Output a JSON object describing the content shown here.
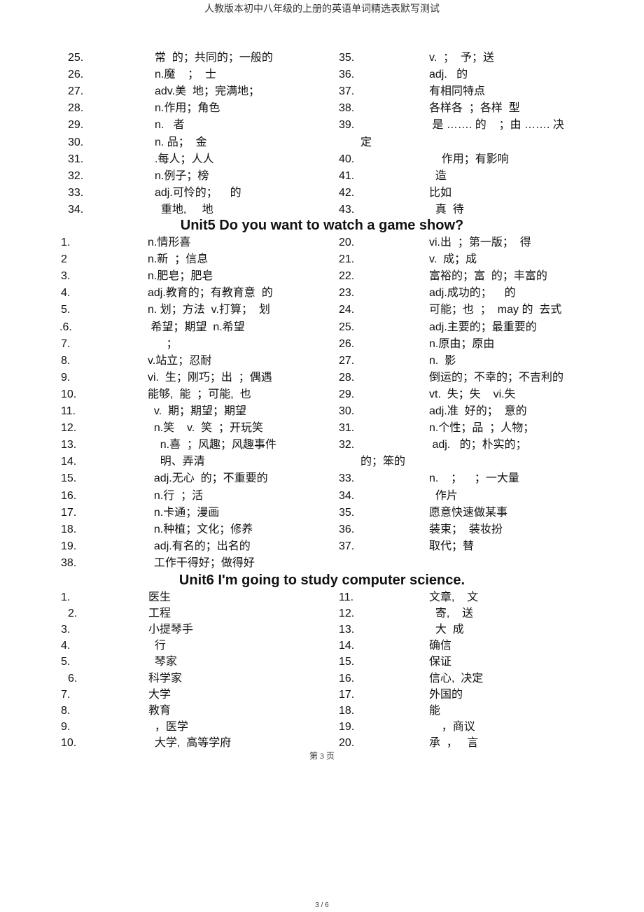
{
  "header": {
    "title": "人教版本初中八年级的上册的英语单词精选表默写测试"
  },
  "section_top": {
    "left": [
      {
        "num": "25.",
        "text": "常  的；共同的；一般的"
      },
      {
        "num": "26.",
        "text": "n.魔    ；  士"
      },
      {
        "num": "27.",
        "text": "adv.美  地；完满地；"
      },
      {
        "num": "28.",
        "text": "n.作用；角色"
      },
      {
        "num": "29.",
        "text": "n.   者"
      },
      {
        "num": "30.",
        "text": "n. 品；  金"
      },
      {
        "num": "31.",
        "text": ".每人；人人"
      },
      {
        "num": "32.",
        "text": "n.例子；榜"
      },
      {
        "num": "33.",
        "text": "adj.可怜的；    的"
      },
      {
        "num": "34.",
        "text": "  重地,     地"
      }
    ],
    "right": [
      {
        "num": "35.",
        "text": "v.  ；  予；送"
      },
      {
        "num": "36.",
        "text": "adj.   的"
      },
      {
        "num": "37.",
        "text": "有相同特点"
      },
      {
        "num": "38.",
        "text": "各样各  ；各样  型"
      },
      {
        "num": "39.",
        "text": " 是 ……. 的    ；由 ……. 决"
      },
      {
        "num": "",
        "text": "定"
      },
      {
        "num": "40.",
        "text": "    作用；有影响"
      },
      {
        "num": "41.",
        "text": "  造"
      },
      {
        "num": "42.",
        "text": "比如"
      },
      {
        "num": "43.",
        "text": "  真  待"
      }
    ]
  },
  "unit5": {
    "heading": "Unit5 Do you want to watch a game show?",
    "left": [
      {
        "num": "1.",
        "text": "n.情形喜"
      },
      {
        "num": "2",
        "text": "n.新  ；信息"
      },
      {
        "num": "3.",
        "text": "n.肥皂；肥皂"
      },
      {
        "num": "4.",
        "text": "adj.教育的；有教育意  的"
      },
      {
        "num": "5.",
        "text": "n. 划；方法  v.打算；  划"
      },
      {
        "num": ".6.",
        "text": " 希望；期望  n.希望"
      },
      {
        "num": "7.",
        "text": "      ；"
      },
      {
        "num": "8.",
        "text": "v.站立；忍耐"
      },
      {
        "num": "9.",
        "text": "vi.  生；刚巧；出  ；偶遇"
      },
      {
        "num": "10.",
        "text": "能够,  能  ；可能,  也"
      },
      {
        "num": "11.",
        "text": "  v.  期；期望；期望"
      },
      {
        "num": "12.",
        "text": "  n.笑    v.  笑  ；开玩笑"
      },
      {
        "num": "13.",
        "text": "    n.喜  ；风趣；风趣事件"
      },
      {
        "num": "14.",
        "text": "    明、弄清"
      },
      {
        "num": "15.",
        "text": "  adj.无心  的；不重要的"
      },
      {
        "num": "16.",
        "text": "  n.行  ；活"
      },
      {
        "num": "17.",
        "text": "  n.卡通；漫画"
      },
      {
        "num": "18.",
        "text": "  n.种植；文化；修养"
      },
      {
        "num": "19.",
        "text": "  adj.有名的；出名的"
      },
      {
        "num": "38.",
        "text": "  工作干得好；做得好"
      }
    ],
    "right": [
      {
        "num": "20.",
        "text": "vi.出  ；第一版；  得"
      },
      {
        "num": "21.",
        "text": "v.  成；成"
      },
      {
        "num": "22.",
        "text": "富裕的；富  的；丰富的"
      },
      {
        "num": "23.",
        "text": "adj.成功的；    的"
      },
      {
        "num": "24.",
        "text": "可能；也  ；  may 的  去式"
      },
      {
        "num": "25.",
        "text": "adj.主要的；最重要的"
      },
      {
        "num": "26.",
        "text": "n.原由；原由"
      },
      {
        "num": "27.",
        "text": "n.  影"
      },
      {
        "num": "28.",
        "text": "倒运的；不幸的；不吉利的"
      },
      {
        "num": "29.",
        "text": "vt.  失；失    vi.失"
      },
      {
        "num": "30.",
        "text": "adj.准  好的；  意的"
      },
      {
        "num": "31.",
        "text": "n.个性；品  ；人物；"
      },
      {
        "num": "32.",
        "text": " adj.   的；朴实的；"
      },
      {
        "num": "",
        "text": "的；笨的"
      },
      {
        "num": "33.",
        "text": "n.    ；    ；一大量"
      },
      {
        "num": "34.",
        "text": "  作片"
      },
      {
        "num": "35.",
        "text": "愿意快速做某事"
      },
      {
        "num": "36.",
        "text": "装束；  装妆扮"
      },
      {
        "num": "37.",
        "text": "取代；替"
      }
    ]
  },
  "unit6": {
    "heading": "Unit6 I'm going to study computer science.",
    "left": [
      {
        "num": "1.",
        "text": "医生"
      },
      {
        "num": "2.",
        "text": "工程"
      },
      {
        "num": "3.",
        "text": "小提琴手"
      },
      {
        "num": "4.",
        "text": "  行"
      },
      {
        "num": "5.",
        "text": "  琴家"
      },
      {
        "num": "6.",
        "text": "科学家"
      },
      {
        "num": "7.",
        "text": "大学"
      },
      {
        "num": "8.",
        "text": "教育"
      },
      {
        "num": "9.",
        "text": "  ，医学"
      },
      {
        "num": "10.",
        "text": "  大学,  高等学府"
      }
    ],
    "right": [
      {
        "num": "11.",
        "text": "文章,    文"
      },
      {
        "num": "12.",
        "text": "  寄,    送"
      },
      {
        "num": "13.",
        "text": "  大  成"
      },
      {
        "num": "14.",
        "text": "确信"
      },
      {
        "num": "15.",
        "text": "保证"
      },
      {
        "num": "16.",
        "text": "信心,  决定"
      },
      {
        "num": "17.",
        "text": "外国的"
      },
      {
        "num": "18.",
        "text": "能"
      },
      {
        "num": "19.",
        "text": "    ，商议"
      },
      {
        "num": "20.",
        "text": "承  ，   言"
      }
    ]
  },
  "footer": {
    "page_label": "第 3 页",
    "page_count": "3 / 6"
  }
}
